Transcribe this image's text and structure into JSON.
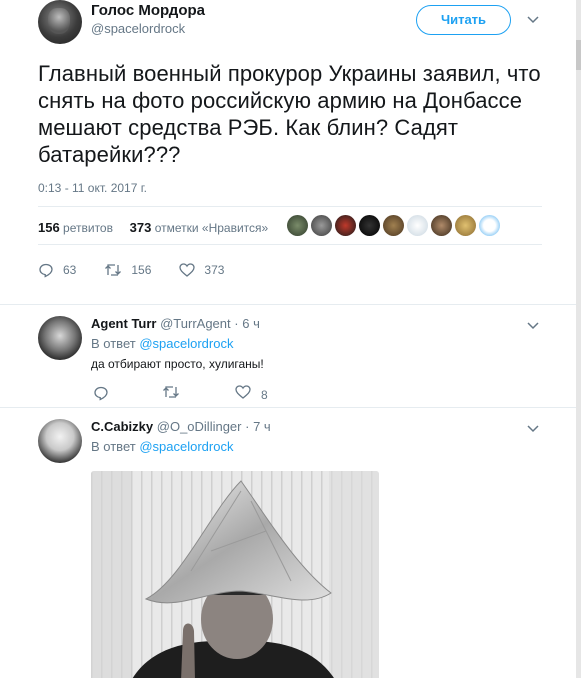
{
  "tweet": {
    "author_name": "Голос Мордора",
    "author_handle": "@spacelordrock",
    "follow_label": "Читать",
    "text": "Главный военный прокурор Украины заявил, что снять на фото российскую армию на Донбассе мешают средства РЭБ. Как блин? Садят батарейки???",
    "timestamp": "0:13 - 11 окт. 2017 г.",
    "retweets_count": "156",
    "retweets_label": "ретвитов",
    "likes_count": "373",
    "likes_label": "отметки «Нравится»",
    "actions": {
      "replies": "63",
      "retweets": "156",
      "likes": "373"
    }
  },
  "replies": [
    {
      "name": "Agent Turr",
      "handle": "@TurrAgent",
      "time": "6 ч",
      "in_reply_prefix": "В ответ",
      "in_reply_to": "@spacelordrock",
      "text": "да отбирают просто, хулиганы!",
      "likes": "8"
    },
    {
      "name": "C.Cabizky",
      "handle": "@O_oDillinger",
      "time": "7 ч",
      "in_reply_prefix": "В ответ",
      "in_reply_to": "@spacelordrock"
    }
  ],
  "colors": {
    "accent": "#1da1f2",
    "secondary_text": "#657786",
    "divider": "#e6ecf0"
  },
  "icons": [
    "chevron-down-icon",
    "reply-icon",
    "retweet-icon",
    "like-icon"
  ]
}
